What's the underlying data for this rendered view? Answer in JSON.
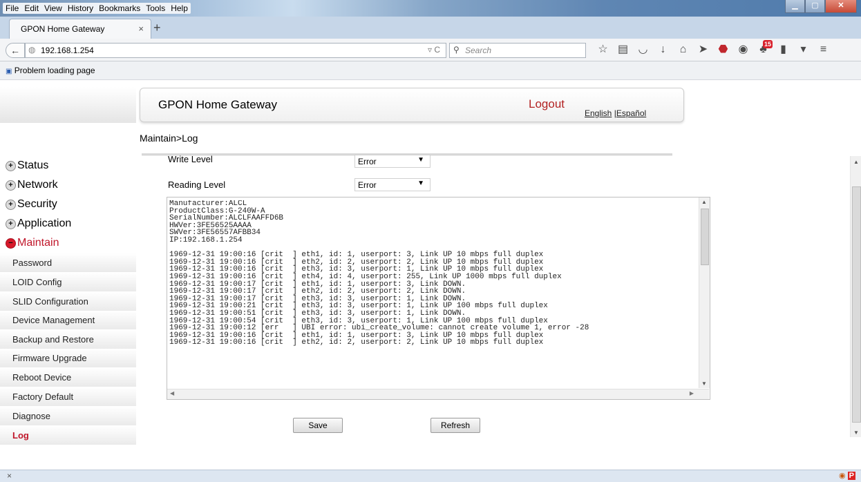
{
  "browser": {
    "menu": [
      "File",
      "Edit",
      "View",
      "History",
      "Bookmarks",
      "Tools",
      "Help"
    ],
    "tab_title": "GPON Home Gateway",
    "tab_close": "×",
    "new_tab": "+",
    "url": "192.168.1.254",
    "search_placeholder": "Search",
    "bookmark": "Problem loading page",
    "badge_count": "15",
    "status_close": "×"
  },
  "header": {
    "title": "GPON Home Gateway",
    "logout": "Logout",
    "lang_english": "English",
    "lang_sep": "|",
    "lang_spanish": "Español"
  },
  "breadcrumb": "Maintain>Log",
  "sidebar": {
    "top": [
      {
        "label": "Status",
        "icon": "+"
      },
      {
        "label": "Network",
        "icon": "+"
      },
      {
        "label": "Security",
        "icon": "+"
      },
      {
        "label": "Application",
        "icon": "+"
      },
      {
        "label": "Maintain",
        "icon": "−"
      }
    ],
    "sub": [
      "Password",
      "LOID Config",
      "SLID Configuration",
      "Device Management",
      "Backup and Restore",
      "Firmware Upgrade",
      "Reboot Device",
      "Factory Default",
      "Diagnose",
      "Log"
    ]
  },
  "form": {
    "write_label": "Write Level",
    "write_value": "Error",
    "read_label": "Reading Level",
    "read_value": "Error",
    "log": "Manufacturer:ALCL\nProductClass:G-240W-A\nSerialNumber:ALCLFAAFFD6B\nHWVer:3FE56525AAAA\nSWVer:3FE56557AFBB34\nIP:192.168.1.254\n\n1969-12-31 19:00:16 [crit  ] eth1, id: 1, userport: 3, Link UP 10 mbps full duplex\n1969-12-31 19:00:16 [crit  ] eth2, id: 2, userport: 2, Link UP 10 mbps full duplex\n1969-12-31 19:00:16 [crit  ] eth3, id: 3, userport: 1, Link UP 10 mbps full duplex\n1969-12-31 19:00:16 [crit  ] eth4, id: 4, userport: 255, Link UP 1000 mbps full duplex\n1969-12-31 19:00:17 [crit  ] eth1, id: 1, userport: 3, Link DOWN.\n1969-12-31 19:00:17 [crit  ] eth2, id: 2, userport: 2, Link DOWN.\n1969-12-31 19:00:17 [crit  ] eth3, id: 3, userport: 1, Link DOWN.\n1969-12-31 19:00:21 [crit  ] eth3, id: 3, userport: 1, Link UP 100 mbps full duplex\n1969-12-31 19:00:51 [crit  ] eth3, id: 3, userport: 1, Link DOWN.\n1969-12-31 19:00:54 [crit  ] eth3, id: 3, userport: 1, Link UP 100 mbps full duplex\n1969-12-31 19:00:12 [err   ] UBI error: ubi_create_volume: cannot create volume 1, error -28\n1969-12-31 19:00:16 [crit  ] eth1, id: 1, userport: 3, Link UP 10 mbps full duplex\n1969-12-31 19:00:16 [crit  ] eth2, id: 2, userport: 2, Link UP 10 mbps full duplex",
    "save": "Save",
    "refresh": "Refresh"
  },
  "colors": {
    "accent": "#c0162a",
    "link": "#222222"
  }
}
